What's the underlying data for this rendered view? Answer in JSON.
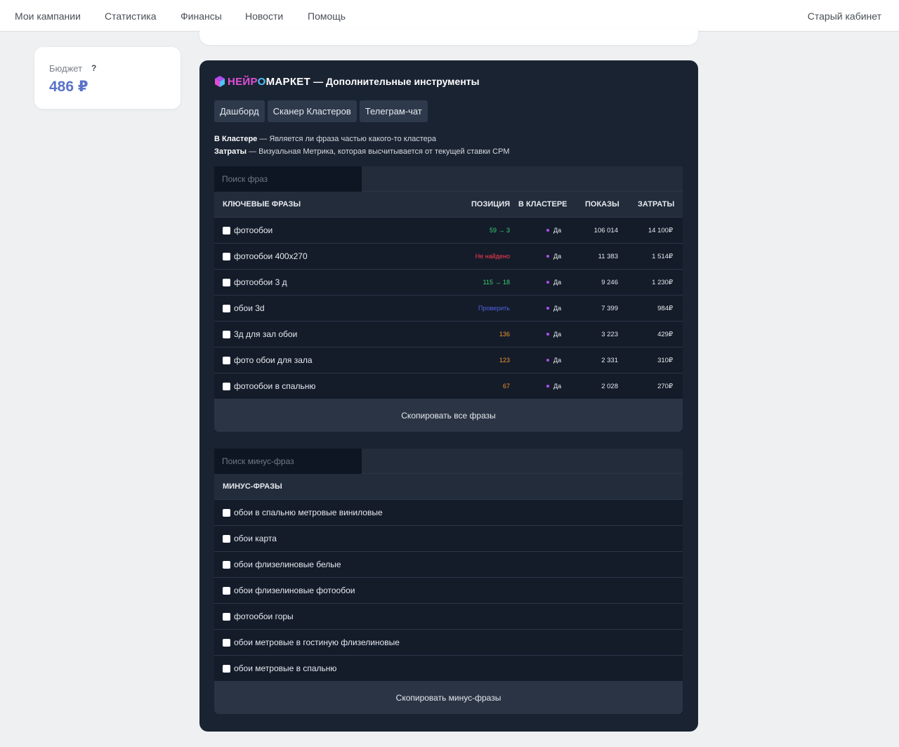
{
  "nav": {
    "items": [
      "Мои кампании",
      "Статистика",
      "Финансы",
      "Новости",
      "Помощь"
    ],
    "right": "Старый кабинет"
  },
  "budget": {
    "label": "Бюджет",
    "help": "?",
    "value": "486 ₽"
  },
  "panel": {
    "brand": {
      "part1": "НЕЙР",
      "part2": "О",
      "part3": "МАРКЕТ",
      "subtitle": "— Дополнительные инструменты"
    },
    "tabs": [
      "Дашборд",
      "Сканер Кластеров",
      "Телеграм-чат"
    ],
    "legend": {
      "line1_term": "В Кластере",
      "line1_text": " — Является ли фраза частью какого-то кластера",
      "line2_term": "Затраты",
      "line2_text": " — Визуальная Метрика, которая высчитывается от текущей ставки CPM"
    },
    "keywords": {
      "search_placeholder": "Поиск фраз",
      "headers": {
        "phrases": "КЛЮЧЕВЫЕ ФРАЗЫ",
        "position": "ПОЗИЦИЯ",
        "cluster": "В КЛАСТЕРЕ",
        "shows": "ПОКАЗЫ",
        "cost": "ЗАТРАТЫ"
      },
      "rows": [
        {
          "phrase": "фотообои",
          "position": "59 → 3",
          "cluster": "Да",
          "shows": "106 014",
          "cost": "14 100₽"
        },
        {
          "phrase": "фотообои 400х270",
          "position": "Не найдено",
          "cluster": "Да",
          "shows": "11 383",
          "cost": "1 514₽"
        },
        {
          "phrase": "фотообои 3 д",
          "position": "115 → 18",
          "cluster": "Да",
          "shows": "9 246",
          "cost": "1 230₽"
        },
        {
          "phrase": "обои 3d",
          "position": "Проверить",
          "cluster": "Да",
          "shows": "7 399",
          "cost": "984₽"
        },
        {
          "phrase": "3д для зал обои",
          "position": "136",
          "cluster": "Да",
          "shows": "3 223",
          "cost": "429₽"
        },
        {
          "phrase": "фото обои для зала",
          "position": "123",
          "cluster": "Да",
          "shows": "2 331",
          "cost": "310₽"
        },
        {
          "phrase": "фотообои в спальню",
          "position": "67",
          "cluster": "Да",
          "shows": "2 028",
          "cost": "270₽"
        }
      ],
      "copy_button": "Скопировать все фразы"
    },
    "minus": {
      "search_placeholder": "Поиск минус-фраз",
      "header": "МИНУС-ФРАЗЫ",
      "rows": [
        "обои в спальню метровые виниловые",
        "обои карта",
        "обои флизелиновые белые",
        "обои флизелиновые фотообои",
        "фотообои горы",
        "обои метровые в гостиную флизелиновые",
        "обои метровые в спальню"
      ],
      "copy_button": "Скопировать минус-фразы"
    }
  },
  "colors": {
    "position_up": "#3ccf6e",
    "position_missing": "#ff3b4f",
    "position_check": "#4f63e0",
    "position_plain": "#f0952a"
  }
}
